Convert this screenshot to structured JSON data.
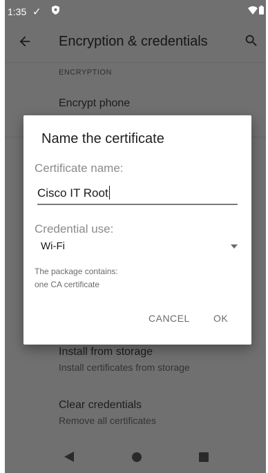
{
  "status_bar": {
    "time": "1:35",
    "check_glyph": "✓",
    "icons": [
      "check-icon",
      "shield-icon",
      "wifi-icon",
      "battery-icon"
    ]
  },
  "toolbar": {
    "title": "Encryption & credentials",
    "back_icon": "arrow-back-icon",
    "search_icon": "search-icon"
  },
  "settings": {
    "section_header": "ENCRYPTION",
    "items": [
      {
        "title": "Encrypt phone",
        "subtitle": ""
      },
      {
        "title": "Install from storage",
        "subtitle": "Install certificates from storage"
      },
      {
        "title": "Clear credentials",
        "subtitle": "Remove all certificates"
      }
    ]
  },
  "dialog": {
    "title": "Name the certificate",
    "cert_name_label": "Certificate name:",
    "cert_name_value": "Cisco IT Root",
    "credential_use_label": "Credential use:",
    "credential_use_value": "Wi-Fi",
    "info_lines": [
      "The package contains:",
      "one CA certificate"
    ],
    "cancel_label": "CANCEL",
    "ok_label": "OK"
  },
  "nav_bar": {
    "icons": [
      "nav-back-icon",
      "nav-home-icon",
      "nav-recents-icon"
    ]
  },
  "colors": {
    "scrim_background": "#707070",
    "dialog_background": "#ffffff",
    "hint_text": "#8a8a8a",
    "button_text": "#6b6b6b"
  }
}
